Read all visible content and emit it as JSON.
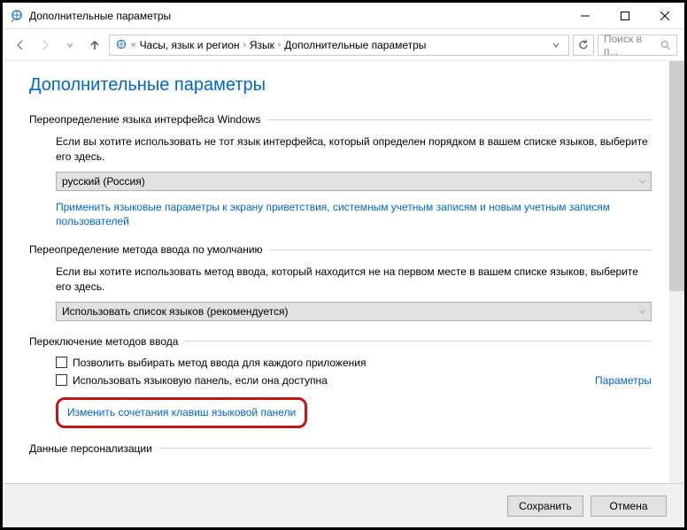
{
  "titlebar": {
    "title": "Дополнительные параметры"
  },
  "breadcrumb": {
    "items": [
      "Часы, язык и регион",
      "Язык",
      "Дополнительные параметры"
    ]
  },
  "search": {
    "placeholder": "Поиск в п..."
  },
  "page": {
    "title": "Дополнительные параметры"
  },
  "section1": {
    "title": "Переопределение языка интерфейса Windows",
    "text": "Если вы хотите использовать не тот язык интерфейса, который определен порядком в вашем списке языков, выберите его здесь.",
    "dropdown": "русский (Россия)",
    "link": "Применить языковые параметры к экрану приветствия, системным учетным записям и новым учетным записям пользователей"
  },
  "section2": {
    "title": "Переопределение метода ввода по умолчанию",
    "text": "Если вы хотите использовать метод ввода, который находится не на первом месте в вашем списке языков, выберите его здесь.",
    "dropdown": "Использовать список языков (рекомендуется)"
  },
  "section3": {
    "title": "Переключение методов ввода",
    "checkbox1": "Позволить выбирать метод ввода для каждого приложения",
    "checkbox2": "Использовать языковую панель, если она доступна",
    "params": "Параметры",
    "link": "Изменить сочетания клавиш языковой панели"
  },
  "section4": {
    "title": "Данные персонализации"
  },
  "footer": {
    "save": "Сохранить",
    "cancel": "Отмена"
  }
}
